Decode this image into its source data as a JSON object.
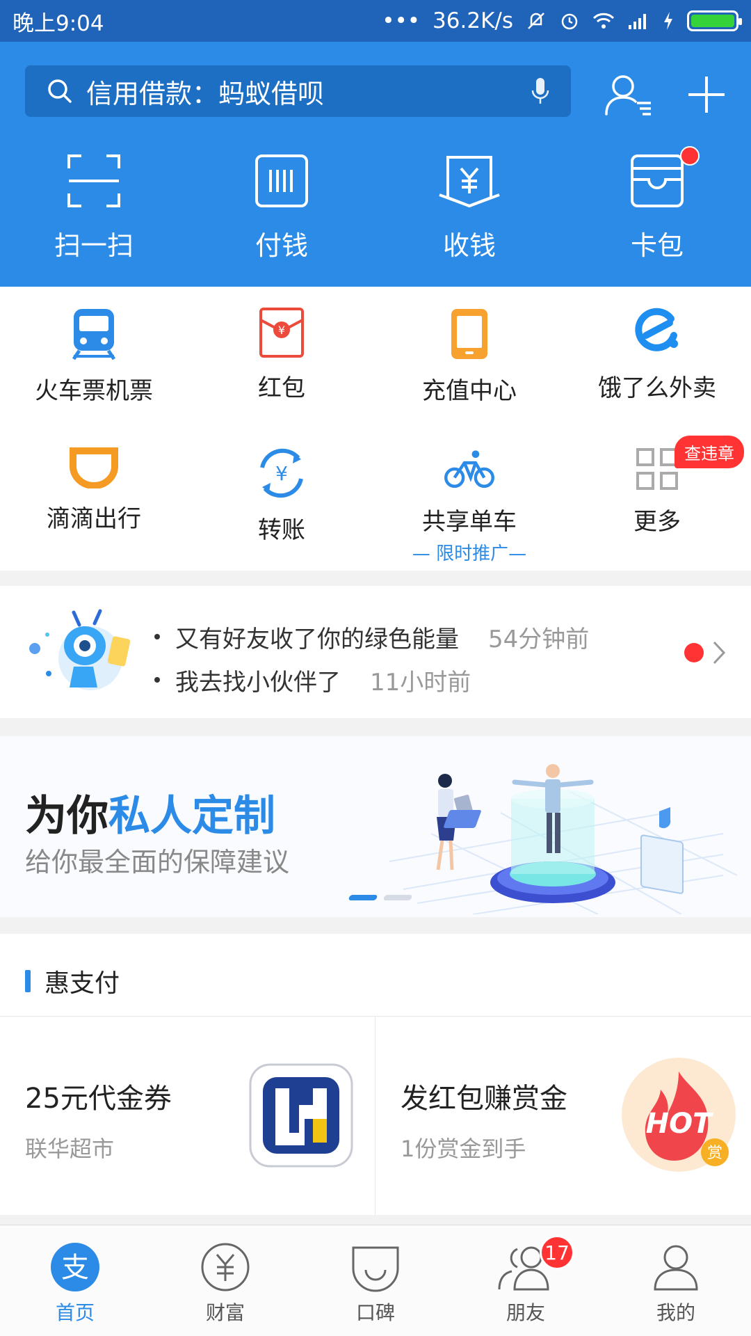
{
  "status_bar": {
    "time": "晚上9:04",
    "dots": "•••",
    "speed": "36.2K/s",
    "battery_level": 1.0
  },
  "search": {
    "placeholder": "信用借款：蚂蚁借呗"
  },
  "quick_actions": [
    {
      "label": "扫一扫",
      "icon": "scan-icon"
    },
    {
      "label": "付钱",
      "icon": "barcode-icon"
    },
    {
      "label": "收钱",
      "icon": "yuan-receive-icon"
    },
    {
      "label": "卡包",
      "icon": "wallet-icon",
      "has_dot": true
    }
  ],
  "apps": [
    {
      "label": "火车票机票",
      "icon": "train-icon"
    },
    {
      "label": "红包",
      "icon": "red-envelope-icon"
    },
    {
      "label": "充值中心",
      "icon": "phone-recharge-icon"
    },
    {
      "label": "饿了么外卖",
      "icon": "eleme-icon"
    },
    {
      "label": "滴滴出行",
      "icon": "didi-icon"
    },
    {
      "label": "转账",
      "icon": "transfer-icon"
    },
    {
      "label": "共享单车",
      "icon": "bike-icon",
      "sub": "— 限时推广—"
    },
    {
      "label": "更多",
      "icon": "more-grid-icon",
      "tag": "查违章"
    }
  ],
  "notice": {
    "messages": [
      {
        "text": "又有好友收了你的绿色能量",
        "time": "54分钟前"
      },
      {
        "text": "我去找小伙伴了",
        "time": "11小时前"
      }
    ]
  },
  "banner": {
    "title_plain": "为你",
    "title_highlight": "私人定制",
    "subtitle": "给你最全面的保障建议"
  },
  "hui": {
    "title": "惠支付",
    "cards": [
      {
        "title": "25元代金券",
        "subtitle": "联华超市",
        "logo": "lianhua-logo"
      },
      {
        "title": "发红包赚赏金",
        "subtitle": "1份赏金到手",
        "logo": "hot-flame-logo",
        "logo_text": "HOT",
        "logo_badge": "赏"
      }
    ]
  },
  "tabs": [
    {
      "label": "首页",
      "icon": "alipay-home-icon",
      "active": true
    },
    {
      "label": "财富",
      "icon": "wealth-icon"
    },
    {
      "label": "口碑",
      "icon": "koubei-icon"
    },
    {
      "label": "朋友",
      "icon": "friends-icon",
      "badge": "17"
    },
    {
      "label": "我的",
      "icon": "me-icon"
    }
  ],
  "colors": {
    "primary": "#2b8be6",
    "status_bar": "#1f64b8",
    "badge_red": "#ff3333"
  }
}
